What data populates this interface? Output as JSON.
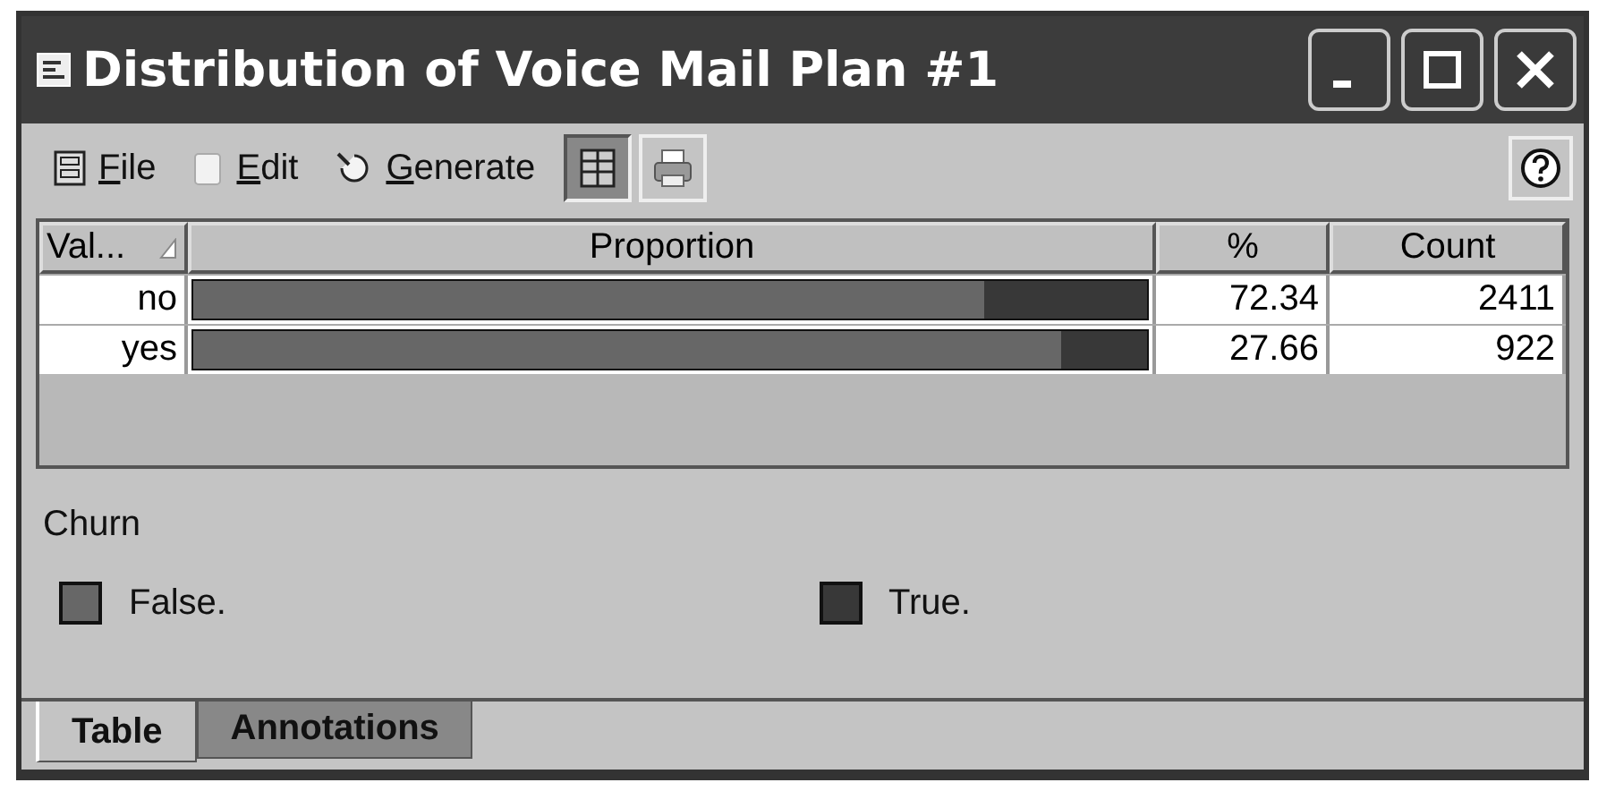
{
  "window": {
    "title": "Distribution of Voice Mail Plan #1"
  },
  "menu": [
    {
      "label": "File",
      "kind": "file"
    },
    {
      "label": "Edit",
      "kind": "edit"
    },
    {
      "label": "Generate",
      "kind": "generate"
    }
  ],
  "table": {
    "columns": [
      "Val...",
      "Proportion",
      "%",
      "Count"
    ],
    "rows": [
      {
        "value": "no",
        "level": 0.83,
        "percent": "72.34",
        "count": "2411"
      },
      {
        "value": "yes",
        "level": 0.91,
        "percent": "27.66",
        "count": "922"
      }
    ]
  },
  "legend": {
    "title": "Churn",
    "items": [
      {
        "label": "False.",
        "color": "#676767"
      },
      {
        "label": "True.",
        "color": "#383838"
      }
    ]
  },
  "tabs": [
    {
      "label": "Table",
      "selected": true
    },
    {
      "label": "Annotations",
      "selected": false
    }
  ]
}
